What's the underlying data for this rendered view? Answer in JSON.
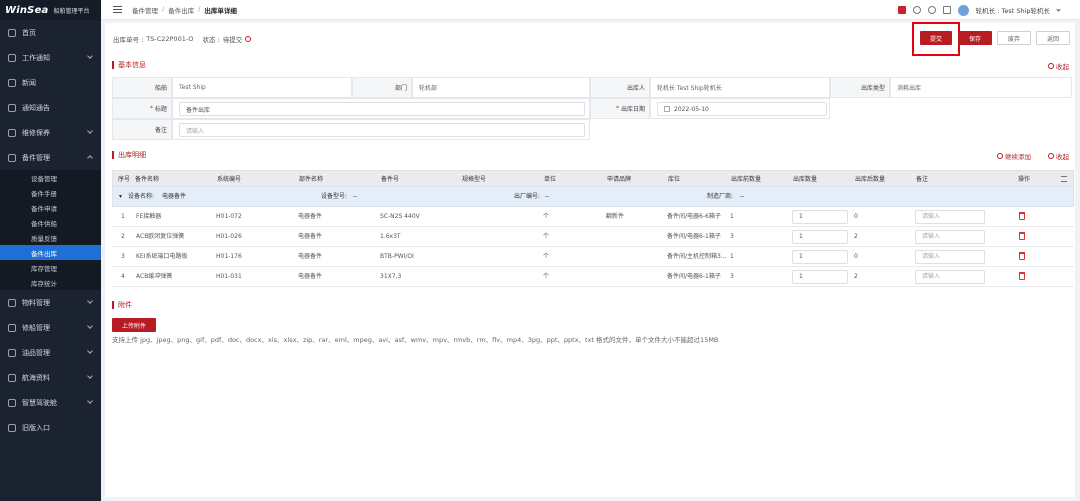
{
  "app": {
    "logo": "WinSea",
    "subtitle": "船舶管理平台"
  },
  "sidebar": {
    "items": [
      {
        "label": "首页",
        "icon": "home-icon",
        "arrow": false
      },
      {
        "label": "工作通知",
        "icon": "notice-icon",
        "arrow": true
      },
      {
        "label": "新闻",
        "icon": "news-icon",
        "arrow": false
      },
      {
        "label": "通知通告",
        "icon": "announce-icon",
        "arrow": false
      },
      {
        "label": "维修保养",
        "icon": "maintenance-icon",
        "arrow": true
      },
      {
        "label": "备件管理",
        "icon": "spare-parts-icon",
        "arrow": true,
        "open": true
      }
    ],
    "sub_items": [
      {
        "label": "设备管理",
        "active": false
      },
      {
        "label": "备件手册",
        "active": false
      },
      {
        "label": "备件申请",
        "active": false
      },
      {
        "label": "备件供船",
        "active": false
      },
      {
        "label": "质量反馈",
        "active": false
      },
      {
        "label": "备件出库",
        "active": true
      },
      {
        "label": "库存管理",
        "active": false
      },
      {
        "label": "库存统计",
        "active": false
      }
    ],
    "items_after": [
      {
        "label": "物料管理",
        "icon": "material-icon",
        "arrow": true
      },
      {
        "label": "修船管理",
        "icon": "repair-icon",
        "arrow": true
      },
      {
        "label": "油品管理",
        "icon": "oil-icon",
        "arrow": true
      },
      {
        "label": "航海资料",
        "icon": "nautical-icon",
        "arrow": true
      },
      {
        "label": "智慧驾驶舱",
        "icon": "cockpit-icon",
        "arrow": true
      },
      {
        "label": "旧版入口",
        "icon": "legacy-icon",
        "arrow": false
      }
    ]
  },
  "topbar": {
    "breadcrumb": [
      "备件管理",
      "备件出库",
      "出库单详细"
    ],
    "separator": "/",
    "user": "轮机长 : Test Ship轮机长"
  },
  "header": {
    "order_label": "出库单号 : ",
    "order_no": "TS-C22P001-O",
    "status_label": "状态 : ",
    "status": "待提交",
    "buttons": {
      "submit": "提交",
      "save": "保存",
      "void": "废弃",
      "back": "返回"
    }
  },
  "basic_info": {
    "title": "基本信息",
    "collapse": "收起",
    "fields": {
      "ship_label": "船舶",
      "ship": "Test Ship",
      "dept_label": "部门",
      "dept": "轮机部",
      "out_person_label": "出库人",
      "out_person": "轮机长 Test Ship轮机长",
      "out_type_label": "出库类型",
      "out_type": "消耗出库",
      "title_label": "标题",
      "title_value": "备件出库",
      "date_label": "出库日期",
      "date": "2022-05-10",
      "remark_label": "备注",
      "remark_placeholder": "请输入"
    }
  },
  "detail": {
    "title": "出库明细",
    "continue_add": "继续添加",
    "collapse": "收起",
    "columns": [
      "序号",
      "备件名称",
      "系统编号",
      "部件名称",
      "备件号",
      "规格型号",
      "单位",
      "申请品牌",
      "库位",
      "出库前数量",
      "出库数量",
      "出库后数量",
      "备注",
      "操作"
    ],
    "group": {
      "device_name_label": "设备名称:",
      "device_name": "电器备件",
      "device_model_label": "设备型号:",
      "device_model": "--",
      "factory_no_label": "出厂编号:",
      "factory_no": "--",
      "maker_label": "制造厂商:",
      "maker": "--"
    },
    "rows": [
      {
        "no": "1",
        "name": "FE接触器",
        "sys_no": "H01-072",
        "part": "电器备件",
        "spare_no": "SC-N2S 440V",
        "model": "",
        "unit": "个",
        "brand": "翻新件",
        "location": "备件间/电器6-6箱子",
        "before": "1",
        "qty": "1",
        "after": "0",
        "remark_placeholder": "请输入"
      },
      {
        "no": "2",
        "name": "ACB欧闭复位弹簧",
        "sys_no": "H01-026",
        "part": "电器备件",
        "spare_no": "1.6x3T",
        "model": "",
        "unit": "个",
        "brand": "",
        "location": "备件间/电器6-1箱子",
        "before": "3",
        "qty": "1",
        "after": "2",
        "remark_placeholder": "请输入"
      },
      {
        "no": "3",
        "name": "KEI系统端口电路板",
        "sys_no": "H01-176",
        "part": "电器备件",
        "spare_no": "BTB-PWI/OI",
        "model": "",
        "unit": "个",
        "brand": "",
        "location": "备件间/主机控制箱3...",
        "before": "1",
        "qty": "1",
        "after": "0",
        "remark_placeholder": "请输入"
      },
      {
        "no": "4",
        "name": "ACB缓冲弹簧",
        "sys_no": "H01-031",
        "part": "电器备件",
        "spare_no": "31X7.3",
        "model": "",
        "unit": "个",
        "brand": "",
        "location": "备件间/电器6-1箱子",
        "before": "3",
        "qty": "1",
        "after": "2",
        "remark_placeholder": "请输入"
      }
    ]
  },
  "attachment": {
    "title": "附件",
    "upload": "上传附件",
    "hint": "支持上传 jpg、jpeg、png、gif、pdf、doc、docx、xls、xlsx、zip、rar、eml、mpeg、avi、asf、wmv、mpv、rmvb、rm、flv、mp4、3pg、ppt、pptx、txt 格式的文件，单个文件大小不能超过15MB"
  },
  "colors": {
    "brand_red": "#b81c22",
    "sidebar_bg": "#1c2330",
    "active_blue": "#1f6fd6",
    "highlight": "#e60012"
  }
}
